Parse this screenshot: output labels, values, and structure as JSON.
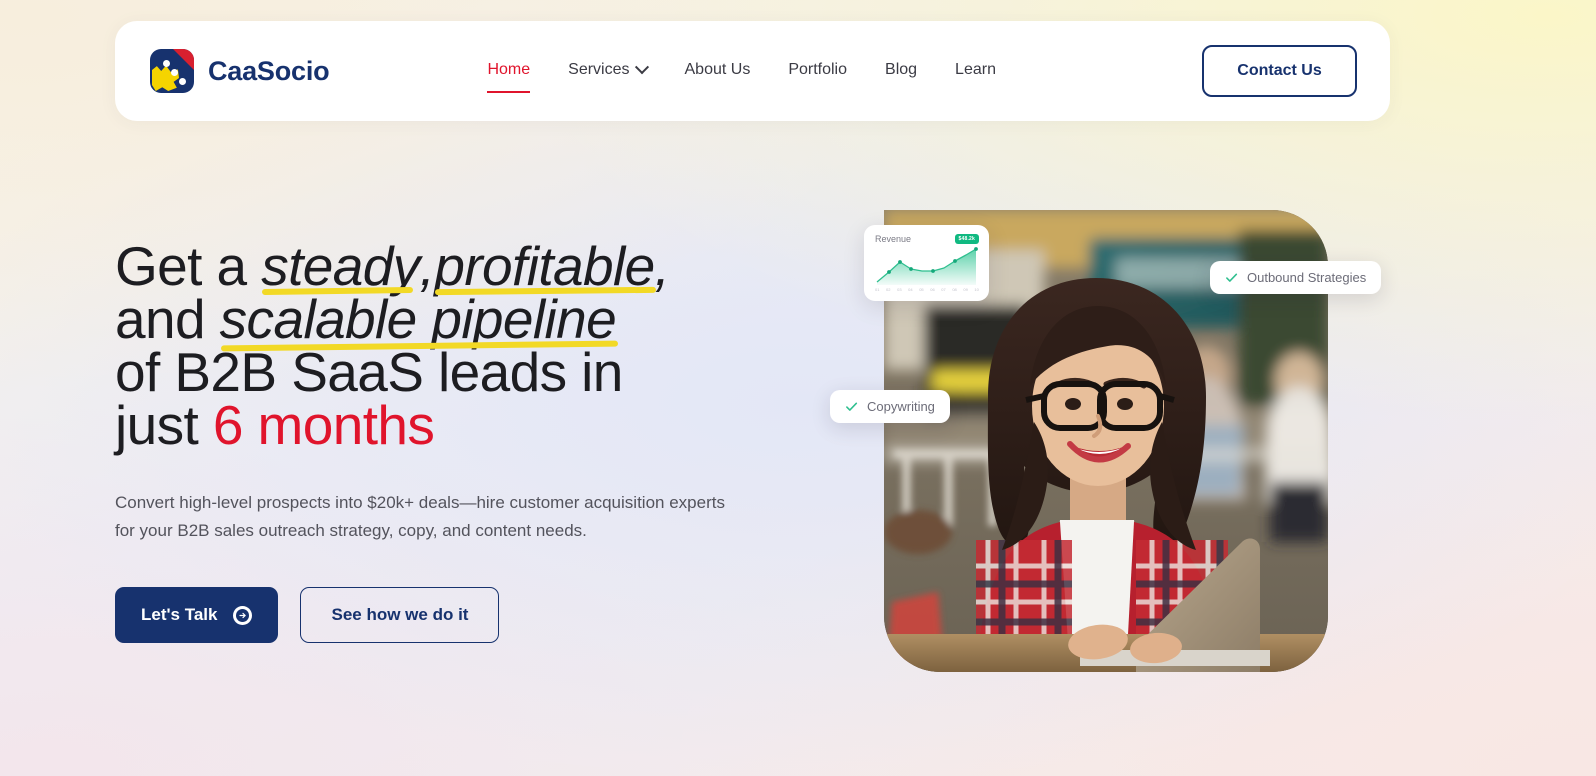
{
  "brand": {
    "name": "CaaSocio",
    "logo_icon": "caasocio-logo-icon"
  },
  "nav": {
    "items": [
      {
        "label": "Home",
        "active": true,
        "has_dropdown": false
      },
      {
        "label": "Services",
        "active": false,
        "has_dropdown": true
      },
      {
        "label": "About Us",
        "active": false,
        "has_dropdown": false
      },
      {
        "label": "Portfolio",
        "active": false,
        "has_dropdown": false
      },
      {
        "label": "Blog",
        "active": false,
        "has_dropdown": false
      },
      {
        "label": "Learn",
        "active": false,
        "has_dropdown": false
      }
    ],
    "contact_button": "Contact Us"
  },
  "hero": {
    "headline": {
      "part1": "Get a ",
      "em1": "steady",
      "comma1": ", ",
      "em2": "profitable",
      "comma2": ",",
      "part2": "and ",
      "em3": "scalable pipeline",
      "part3": "of B2B SaaS leads in",
      "part4": "just ",
      "highlight_months": "6 months"
    },
    "subtext": "Convert high-level prospects into $20k+ deals—hire customer acquisition experts for your B2B sales outreach strategy, copy, and content needs.",
    "primary_cta": "Let's Talk",
    "primary_cta_icon": "arrow-right-circle-icon",
    "secondary_cta": "See how we do it"
  },
  "hero_cards": {
    "revenue": {
      "title": "Revenue",
      "badge": "$48.2k",
      "badge_icon": "growth-badge"
    },
    "copywriting": {
      "label": "Copywriting",
      "icon": "check-icon"
    },
    "outbound": {
      "label": "Outbound Strategies",
      "icon": "check-icon"
    }
  },
  "chart_data": {
    "type": "area",
    "title": "Revenue",
    "categories": [
      "01",
      "02",
      "03",
      "04",
      "05",
      "06",
      "07",
      "08",
      "09",
      "10"
    ],
    "values": [
      8,
      34,
      52,
      30,
      27,
      27,
      32,
      46,
      62,
      84
    ],
    "xlabel": "",
    "ylabel": "",
    "ylim": [
      0,
      100
    ],
    "grid": false,
    "legend": false,
    "series_color": "#2fbf8f"
  },
  "colors": {
    "brand_navy": "#17326e",
    "accent_red": "#e0142c",
    "highlighter_yellow": "#f2d926",
    "chart_green": "#2fbf8f",
    "logo_yellow": "#f5d400"
  }
}
